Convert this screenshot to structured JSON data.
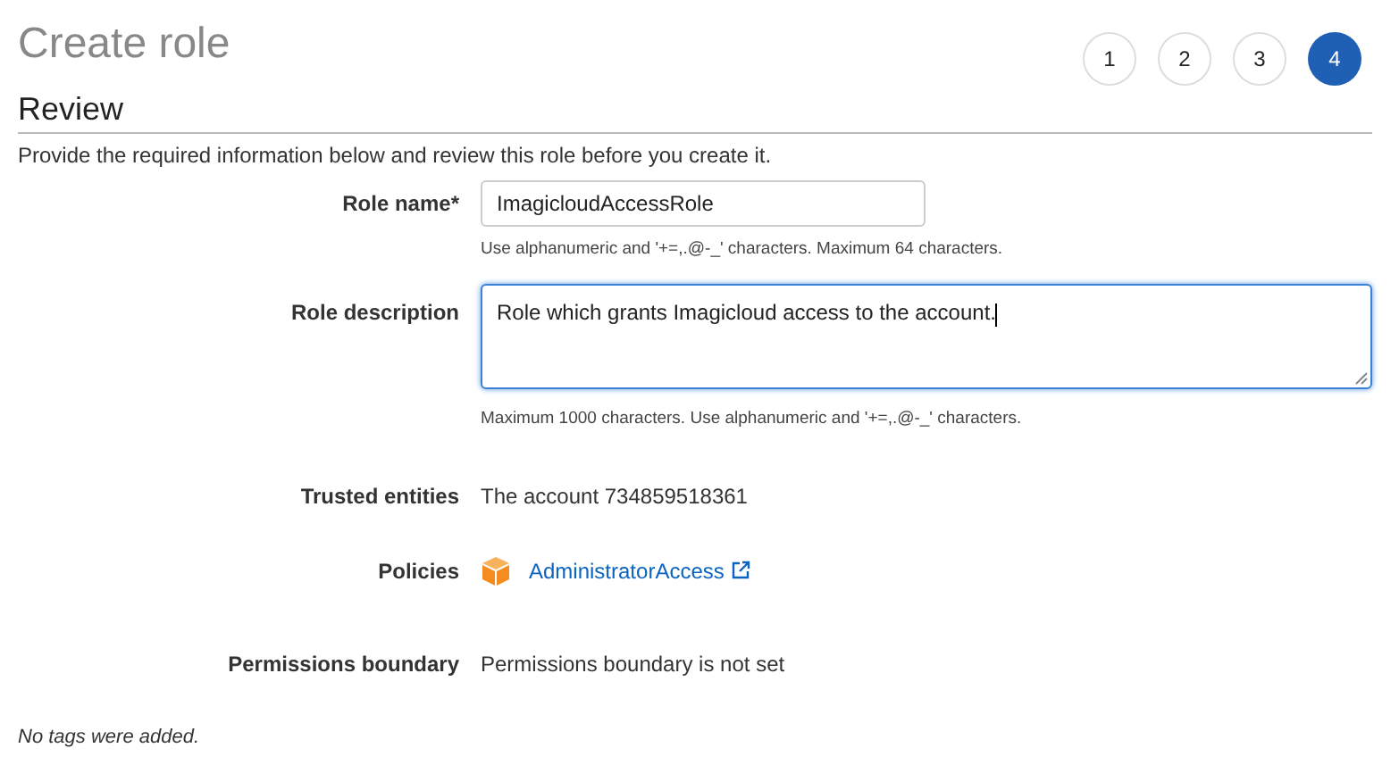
{
  "title": "Create role",
  "steps": [
    {
      "label": "1",
      "selected": false
    },
    {
      "label": "2",
      "selected": false
    },
    {
      "label": "3",
      "selected": false
    },
    {
      "label": "4",
      "selected": true
    }
  ],
  "section": {
    "heading": "Review",
    "intro": "Provide the required information below and review this role before you create it."
  },
  "fields": [
    {
      "kind": "input",
      "label": "Role name*",
      "value": "ImagicloudAccessRole",
      "hint": "Use alphanumeric and '+=,.@-_' characters. Maximum 64 characters.",
      "focused": false
    },
    {
      "kind": "textarea",
      "label": "Role description",
      "value": "Role which grants Imagicloud access to the account.",
      "hint": "Maximum 1000 characters. Use alphanumeric and '+=,.@-_' characters.",
      "focused": true
    },
    {
      "kind": "text",
      "label": "Trusted entities",
      "value": "The account 734859518361"
    },
    {
      "kind": "policy",
      "label": "Policies",
      "value": "AdministratorAccess"
    },
    {
      "kind": "text",
      "label": "Permissions boundary",
      "value": "Permissions boundary is not set"
    }
  ],
  "footer_note": "No tags were added."
}
